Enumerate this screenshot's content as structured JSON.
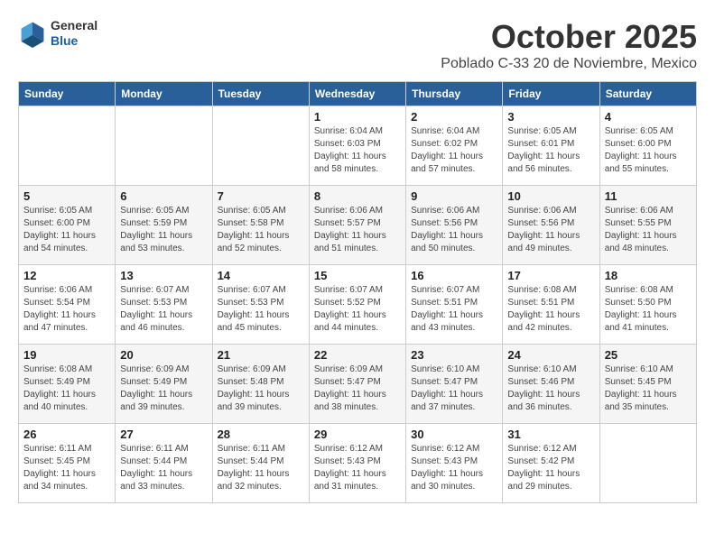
{
  "logo": {
    "line1": "General",
    "line2": "Blue"
  },
  "title": "October 2025",
  "subtitle": "Poblado C-33 20 de Noviembre, Mexico",
  "weekdays": [
    "Sunday",
    "Monday",
    "Tuesday",
    "Wednesday",
    "Thursday",
    "Friday",
    "Saturday"
  ],
  "weeks": [
    [
      {
        "day": "",
        "info": ""
      },
      {
        "day": "",
        "info": ""
      },
      {
        "day": "",
        "info": ""
      },
      {
        "day": "1",
        "info": "Sunrise: 6:04 AM\nSunset: 6:03 PM\nDaylight: 11 hours and 58 minutes."
      },
      {
        "day": "2",
        "info": "Sunrise: 6:04 AM\nSunset: 6:02 PM\nDaylight: 11 hours and 57 minutes."
      },
      {
        "day": "3",
        "info": "Sunrise: 6:05 AM\nSunset: 6:01 PM\nDaylight: 11 hours and 56 minutes."
      },
      {
        "day": "4",
        "info": "Sunrise: 6:05 AM\nSunset: 6:00 PM\nDaylight: 11 hours and 55 minutes."
      }
    ],
    [
      {
        "day": "5",
        "info": "Sunrise: 6:05 AM\nSunset: 6:00 PM\nDaylight: 11 hours and 54 minutes."
      },
      {
        "day": "6",
        "info": "Sunrise: 6:05 AM\nSunset: 5:59 PM\nDaylight: 11 hours and 53 minutes."
      },
      {
        "day": "7",
        "info": "Sunrise: 6:05 AM\nSunset: 5:58 PM\nDaylight: 11 hours and 52 minutes."
      },
      {
        "day": "8",
        "info": "Sunrise: 6:06 AM\nSunset: 5:57 PM\nDaylight: 11 hours and 51 minutes."
      },
      {
        "day": "9",
        "info": "Sunrise: 6:06 AM\nSunset: 5:56 PM\nDaylight: 11 hours and 50 minutes."
      },
      {
        "day": "10",
        "info": "Sunrise: 6:06 AM\nSunset: 5:56 PM\nDaylight: 11 hours and 49 minutes."
      },
      {
        "day": "11",
        "info": "Sunrise: 6:06 AM\nSunset: 5:55 PM\nDaylight: 11 hours and 48 minutes."
      }
    ],
    [
      {
        "day": "12",
        "info": "Sunrise: 6:06 AM\nSunset: 5:54 PM\nDaylight: 11 hours and 47 minutes."
      },
      {
        "day": "13",
        "info": "Sunrise: 6:07 AM\nSunset: 5:53 PM\nDaylight: 11 hours and 46 minutes."
      },
      {
        "day": "14",
        "info": "Sunrise: 6:07 AM\nSunset: 5:53 PM\nDaylight: 11 hours and 45 minutes."
      },
      {
        "day": "15",
        "info": "Sunrise: 6:07 AM\nSunset: 5:52 PM\nDaylight: 11 hours and 44 minutes."
      },
      {
        "day": "16",
        "info": "Sunrise: 6:07 AM\nSunset: 5:51 PM\nDaylight: 11 hours and 43 minutes."
      },
      {
        "day": "17",
        "info": "Sunrise: 6:08 AM\nSunset: 5:51 PM\nDaylight: 11 hours and 42 minutes."
      },
      {
        "day": "18",
        "info": "Sunrise: 6:08 AM\nSunset: 5:50 PM\nDaylight: 11 hours and 41 minutes."
      }
    ],
    [
      {
        "day": "19",
        "info": "Sunrise: 6:08 AM\nSunset: 5:49 PM\nDaylight: 11 hours and 40 minutes."
      },
      {
        "day": "20",
        "info": "Sunrise: 6:09 AM\nSunset: 5:49 PM\nDaylight: 11 hours and 39 minutes."
      },
      {
        "day": "21",
        "info": "Sunrise: 6:09 AM\nSunset: 5:48 PM\nDaylight: 11 hours and 39 minutes."
      },
      {
        "day": "22",
        "info": "Sunrise: 6:09 AM\nSunset: 5:47 PM\nDaylight: 11 hours and 38 minutes."
      },
      {
        "day": "23",
        "info": "Sunrise: 6:10 AM\nSunset: 5:47 PM\nDaylight: 11 hours and 37 minutes."
      },
      {
        "day": "24",
        "info": "Sunrise: 6:10 AM\nSunset: 5:46 PM\nDaylight: 11 hours and 36 minutes."
      },
      {
        "day": "25",
        "info": "Sunrise: 6:10 AM\nSunset: 5:45 PM\nDaylight: 11 hours and 35 minutes."
      }
    ],
    [
      {
        "day": "26",
        "info": "Sunrise: 6:11 AM\nSunset: 5:45 PM\nDaylight: 11 hours and 34 minutes."
      },
      {
        "day": "27",
        "info": "Sunrise: 6:11 AM\nSunset: 5:44 PM\nDaylight: 11 hours and 33 minutes."
      },
      {
        "day": "28",
        "info": "Sunrise: 6:11 AM\nSunset: 5:44 PM\nDaylight: 11 hours and 32 minutes."
      },
      {
        "day": "29",
        "info": "Sunrise: 6:12 AM\nSunset: 5:43 PM\nDaylight: 11 hours and 31 minutes."
      },
      {
        "day": "30",
        "info": "Sunrise: 6:12 AM\nSunset: 5:43 PM\nDaylight: 11 hours and 30 minutes."
      },
      {
        "day": "31",
        "info": "Sunrise: 6:12 AM\nSunset: 5:42 PM\nDaylight: 11 hours and 29 minutes."
      },
      {
        "day": "",
        "info": ""
      }
    ]
  ]
}
